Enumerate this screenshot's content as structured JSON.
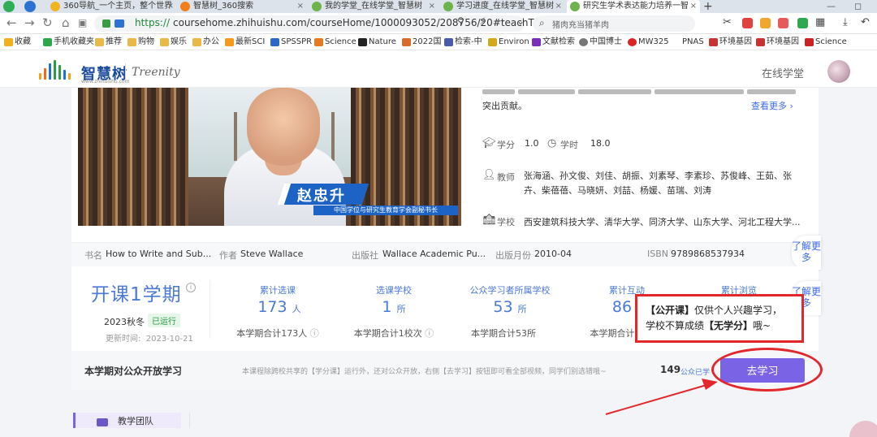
{
  "tabs": [
    {
      "label": "360导航_一个主页，整个世界",
      "color": "#f0b422"
    },
    {
      "label": "智慧树_360搜索",
      "color": "#f27f1d"
    },
    {
      "label": "我的学堂_在线学堂_智慧树",
      "color": "#6bb34a"
    },
    {
      "label": "学习进度_在线学堂_智慧树",
      "color": "#6bb34a"
    },
    {
      "label": "研究生学术表达能力培养一智",
      "color": "#6bb34a"
    }
  ],
  "address": {
    "scheme": "https://",
    "url": "coursehome.zhihuishu.com/courseHome/1000093052/208756/20#teachTe",
    "search_text": "猪肉充当猪羊肉"
  },
  "bookmarks": [
    "收藏",
    "手机收藏夹",
    "推荐",
    "购物",
    "娱乐",
    "办公",
    "最新SCI",
    "SPSSPR",
    "Science",
    "Nature",
    "2022国",
    "检索-中",
    "Environ",
    "文献检索",
    "中国博士",
    "MW325",
    "PNAS",
    "环境基因",
    "环境基因",
    "Science"
  ],
  "site": {
    "logo_cn": "智慧树",
    "logo_url": "www.zhihuishu.com",
    "logo_en": "Treenity",
    "online_label": "在线学堂"
  },
  "video": {
    "name": "赵忠升",
    "subtitle": "中国学位与研究生教育学会副秘书长"
  },
  "course": {
    "desc_tail": "突出贡献。",
    "more_link": "查看更多 ›",
    "credit_label": "学分",
    "credit_value": "1.0",
    "hours_label": "学时",
    "hours_value": "18.0",
    "teacher_label": "教师",
    "teachers": "张海涵、孙文俊、刘佳、胡振、刘素琴、李素珍、苏俊峰、王茹、张卉、柴蓓蓓、马晓妍、刘喆、杨媛、苗瑞、刘涛",
    "school_label": "学校",
    "schools": "西安建筑科技大学、清华大学、同济大学、山东大学、河北工程大学..."
  },
  "book": {
    "title_label": "书名",
    "title_value": "How to Write and Sub...",
    "author_label": "作者",
    "author_value": "Steve Wallace",
    "publisher_label": "出版社",
    "publisher_value": "Wallace Academic Pu...",
    "date_label": "出版月份",
    "date_value": "2010-04",
    "isbn_label": "ISBN",
    "isbn_value": "9789868537934"
  },
  "side_tags": [
    "了解更多",
    "了解更多"
  ],
  "term": {
    "title": "开课1学期",
    "semester": "2023秋冬",
    "status": "已运行",
    "updated_label": "更新时间:",
    "updated_value": "2023-10-21"
  },
  "stats": [
    {
      "head": "累计选课",
      "value": "173",
      "unit": "人",
      "foot": "本学期合计173人"
    },
    {
      "head": "选课学校",
      "value": "1",
      "unit": "所",
      "foot": "本学期合计1校次"
    },
    {
      "head": "公众学习者所属学校",
      "value": "53",
      "unit": "所",
      "foot": "本学期合计53所"
    },
    {
      "head": "累计互动",
      "value": "86",
      "unit": "",
      "foot": "本学期合计"
    },
    {
      "head": "累计浏览",
      "value": "",
      "unit": "",
      "foot": ""
    }
  ],
  "public": {
    "title": "本学期对公众开放学习",
    "desc": "本课程除跨校共享的【学分课】运行外，还对公众开放，右侧【去学习】按钮即可看全部视频，同学们别选错哦~",
    "count": "149",
    "count_label": "公众已学",
    "button": "去学习"
  },
  "callout": {
    "line1_bold": "【公开课】",
    "line1_rest": "仅供个人兴趣学习，",
    "line2_pre": "学校不算成绩",
    "line2_bold": "【无学分】",
    "line2_post": "哦~"
  },
  "bottom_tab": "教学团队",
  "colors": {
    "accent": "#7b63e6",
    "brand": "#4a79d6",
    "annotation": "#e2282d"
  }
}
